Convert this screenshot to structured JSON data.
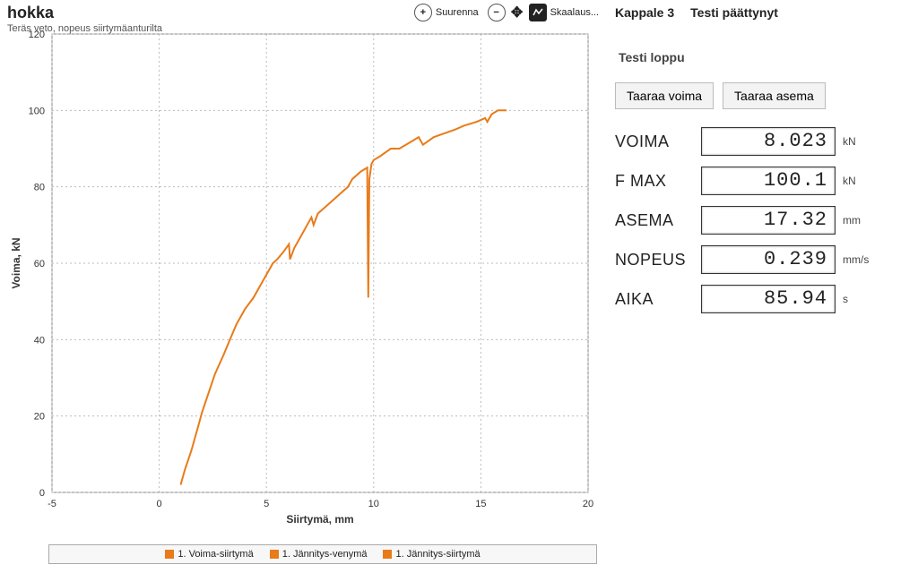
{
  "chart": {
    "title": "hokka",
    "subtitle": "Teräs veto, nopeus siirtymäanturilta",
    "xlabel": "Siirtymä, mm",
    "ylabel": "Voima, kN",
    "toolbar": {
      "zoom_in": "Suurenna",
      "scale": "Skaalaus..."
    },
    "legend": [
      "1. Voima-siirtymä",
      "1. Jännitys-venymä",
      "1. Jännitys-siirtymä"
    ],
    "x_ticks": [
      -5,
      0,
      5,
      10,
      15,
      20
    ],
    "y_ticks": [
      0,
      20,
      40,
      60,
      80,
      100,
      120
    ]
  },
  "chart_data": {
    "type": "line",
    "title": "hokka",
    "xlabel": "Siirtymä, mm",
    "ylabel": "Voima, kN",
    "xlim": [
      -5,
      20
    ],
    "ylim": [
      0,
      120
    ],
    "series": [
      {
        "name": "1. Voima-siirtymä",
        "color": "#e87b1a",
        "x": [
          1.0,
          1.2,
          1.5,
          1.8,
          2.0,
          2.3,
          2.6,
          3.0,
          3.3,
          3.6,
          4.0,
          4.4,
          4.8,
          5.1,
          5.3,
          5.5,
          5.8,
          6.05,
          6.1,
          6.3,
          6.6,
          6.9,
          7.1,
          7.2,
          7.4,
          7.6,
          8.0,
          8.4,
          8.8,
          9.0,
          9.4,
          9.7,
          9.75,
          9.8,
          9.9,
          10.0,
          10.3,
          10.8,
          11.2,
          11.8,
          12.1,
          12.3,
          12.8,
          13.3,
          13.8,
          14.2,
          14.8,
          15.2,
          15.3,
          15.5,
          15.8,
          16.0,
          16.2
        ],
        "y": [
          2,
          6,
          11,
          17,
          21,
          26,
          31,
          36,
          40,
          44,
          48,
          51,
          55,
          58,
          60,
          61,
          63,
          65,
          61,
          64,
          67,
          70,
          72,
          70,
          73,
          74,
          76,
          78,
          80,
          82,
          84,
          85,
          51,
          82,
          86,
          87,
          88,
          90,
          90,
          92,
          93,
          91,
          93,
          94,
          95,
          96,
          97,
          98,
          97,
          99,
          100,
          100,
          100
        ]
      }
    ]
  },
  "right": {
    "header_left": "Kappale 3",
    "header_right": "Testi päättynyt",
    "status": "Testi loppu",
    "btn_taaraa_voima": "Taaraa voima",
    "btn_taaraa_asema": "Taaraa asema",
    "rows": {
      "voima": {
        "label": "VOIMA",
        "value": "8.023",
        "unit": "kN"
      },
      "fmax": {
        "label": "F MAX",
        "value": "100.1",
        "unit": "kN"
      },
      "asema": {
        "label": "ASEMA",
        "value": "17.32",
        "unit": "mm"
      },
      "nopeus": {
        "label": "NOPEUS",
        "value": "0.239",
        "unit": "mm/s"
      },
      "aika": {
        "label": "AIKA",
        "value": "85.94",
        "unit": "s"
      }
    }
  }
}
